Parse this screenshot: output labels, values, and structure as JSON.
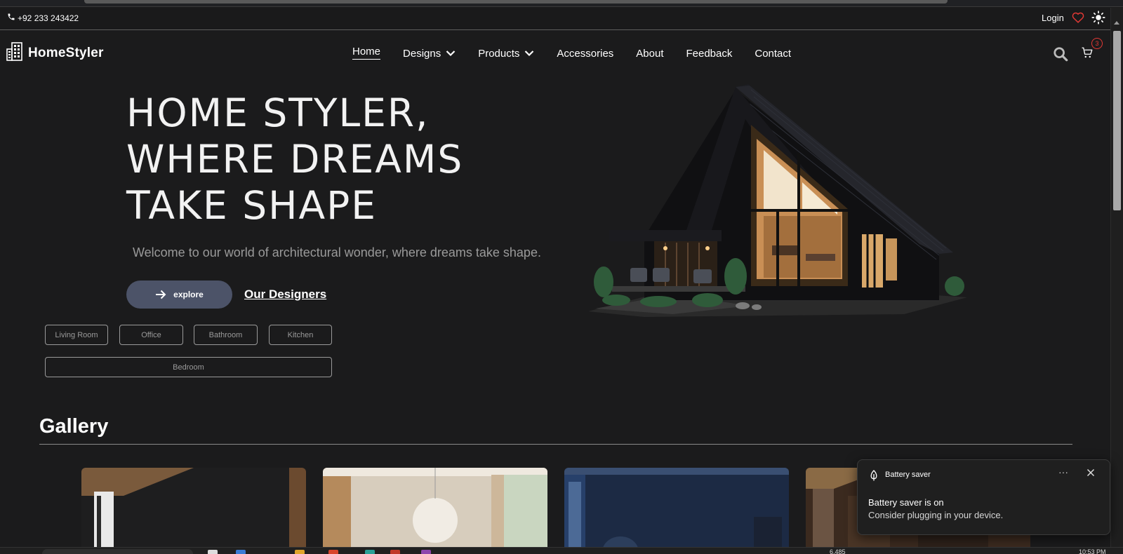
{
  "topbar": {
    "phone": "+92 233 243422",
    "login_label": "Login",
    "icons": [
      "phone-icon",
      "heart-icon",
      "sun-icon"
    ],
    "heart_color": "#e53935"
  },
  "brand": {
    "name": "HomeStyler",
    "icon": "building-icon"
  },
  "nav": {
    "items": [
      {
        "label": "Home",
        "active": true
      },
      {
        "label": "Designs",
        "dropdown": true
      },
      {
        "label": "Products",
        "dropdown": true
      },
      {
        "label": "Accessories"
      },
      {
        "label": "About"
      },
      {
        "label": "Feedback"
      },
      {
        "label": "Contact"
      }
    ],
    "cart_count": "3",
    "icons": [
      "search-icon",
      "cart-icon"
    ]
  },
  "hero": {
    "title_lines": [
      "HOME STYLER,",
      "WHERE DREAMS",
      "TAKE SHAPE"
    ],
    "subtitle": "Welcome to our world of architectural wonder, where dreams take shape.",
    "explore_label": "explore",
    "designers_label": "Our Designers",
    "explore_color": "#4c5368"
  },
  "categories": [
    "Living Room",
    "Office",
    "Bathroom",
    "Kitchen",
    "Bedroom"
  ],
  "gallery": {
    "title": "Gallery"
  },
  "toast": {
    "app": "Battery saver",
    "title": "Battery saver is on",
    "body": "Consider plugging in your device.",
    "more": "···"
  },
  "taskbar": {
    "notif": "6,485",
    "clock": "10:53 PM"
  },
  "colors": {
    "background": "#1b1b1c",
    "accent_red": "#e53935",
    "muted_text": "#9a9a9a"
  }
}
